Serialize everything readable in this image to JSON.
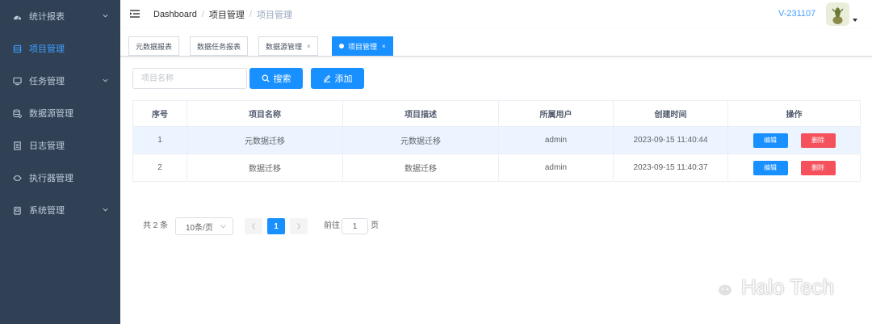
{
  "sidebar": {
    "items": [
      {
        "label": "统计报表",
        "icon": "dashboard-icon",
        "has_children": true,
        "active": false
      },
      {
        "label": "项目管理",
        "icon": "project-icon",
        "has_children": false,
        "active": true
      },
      {
        "label": "任务管理",
        "icon": "monitor-icon",
        "has_children": true,
        "active": false
      },
      {
        "label": "数据源管理",
        "icon": "database-icon",
        "has_children": false,
        "active": false
      },
      {
        "label": "日志管理",
        "icon": "log-icon",
        "has_children": false,
        "active": false
      },
      {
        "label": "执行器管理",
        "icon": "executor-icon",
        "has_children": false,
        "active": false
      },
      {
        "label": "系统管理",
        "icon": "system-icon",
        "has_children": true,
        "active": false
      }
    ]
  },
  "navbar": {
    "breadcrumb": [
      "Dashboard",
      "项目管理",
      "项目管理"
    ],
    "separator": "/",
    "version": "V-231107"
  },
  "tags": [
    {
      "label": "元数据报表",
      "closable": false,
      "active": false
    },
    {
      "label": "数据任务报表",
      "closable": false,
      "active": false
    },
    {
      "label": "数据源管理",
      "closable": true,
      "active": false
    },
    {
      "label": "项目管理",
      "closable": true,
      "active": true
    }
  ],
  "toolbar": {
    "search_placeholder": "项目名称",
    "search_label": "搜索",
    "add_label": "添加"
  },
  "table": {
    "columns": [
      "序号",
      "项目名称",
      "项目描述",
      "所属用户",
      "创建时间",
      "操作"
    ],
    "rows": [
      {
        "index": "1",
        "name": "元数据迁移",
        "desc": "元数据迁移",
        "user": "admin",
        "created": "2023-09-15 11:40:44"
      },
      {
        "index": "2",
        "name": "数据迁移",
        "desc": "数据迁移",
        "user": "admin",
        "created": "2023-09-15 11:40:37"
      }
    ],
    "edit_label": "编辑",
    "delete_label": "删除"
  },
  "pagination": {
    "total": "共 2 条",
    "page_size": "10条/页",
    "current_page": "1",
    "goto_label": "前往",
    "goto_value": "1",
    "page_unit": "页"
  },
  "watermark": "Halo Tech",
  "colors": {
    "sidebar_bg": "#304156",
    "sidebar_text": "#bfcbd9",
    "accent": "#1890ff",
    "danger": "#f4515c",
    "row_highlight": "#ecf5ff"
  }
}
